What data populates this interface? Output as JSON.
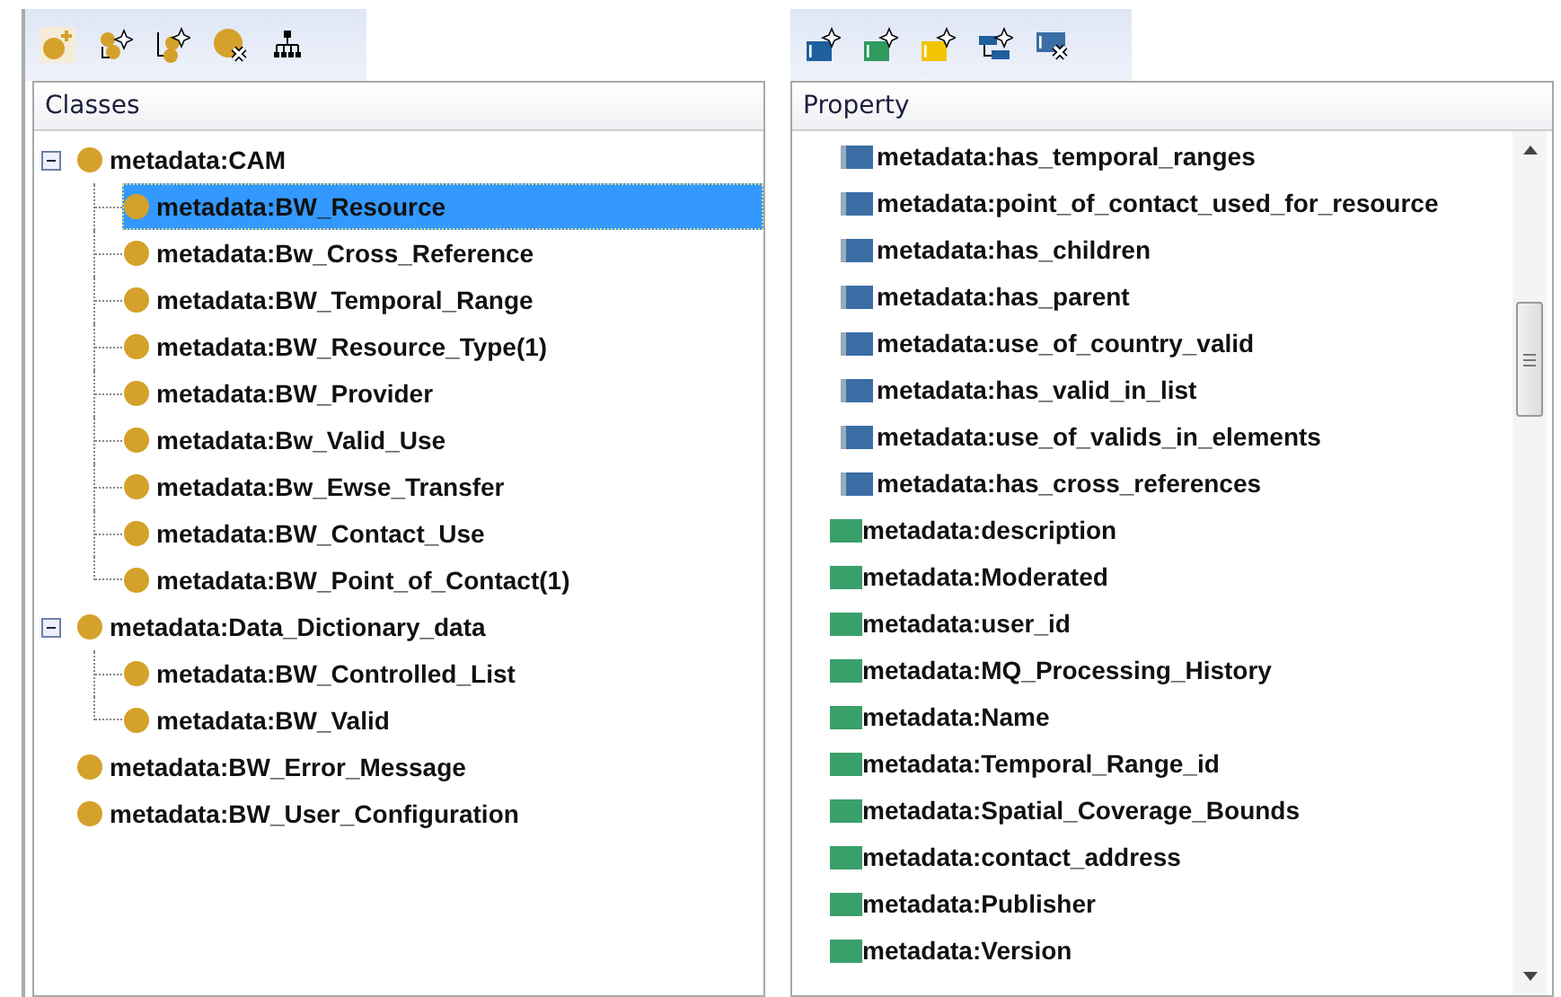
{
  "classes": {
    "title": "Classes",
    "items": [
      {
        "label": "metadata:CAM",
        "expanded": true,
        "selected": false,
        "children": [
          {
            "label": "metadata:BW_Resource",
            "selected": true
          },
          {
            "label": "metadata:Bw_Cross_Reference",
            "selected": false
          },
          {
            "label": "metadata:BW_Temporal_Range",
            "selected": false
          },
          {
            "label": "metadata:BW_Resource_Type(1)",
            "selected": false
          },
          {
            "label": "metadata:BW_Provider",
            "selected": false
          },
          {
            "label": "metadata:Bw_Valid_Use",
            "selected": false
          },
          {
            "label": "metadata:Bw_Ewse_Transfer",
            "selected": false
          },
          {
            "label": "metadata:BW_Contact_Use",
            "selected": false
          },
          {
            "label": "metadata:BW_Point_of_Contact(1)",
            "selected": false
          }
        ]
      },
      {
        "label": "metadata:Data_Dictionary_data",
        "expanded": true,
        "selected": false,
        "children": [
          {
            "label": "metadata:BW_Controlled_List",
            "selected": false
          },
          {
            "label": "metadata:BW_Valid",
            "selected": false
          }
        ]
      },
      {
        "label": "metadata:BW_Error_Message",
        "selected": false
      },
      {
        "label": "metadata:BW_User_Configuration",
        "selected": false
      }
    ]
  },
  "property": {
    "title": "Property",
    "items": [
      {
        "kind": "object",
        "label": "metadata:has_temporal_ranges"
      },
      {
        "kind": "object",
        "label": "metadata:point_of_contact_used_for_resource"
      },
      {
        "kind": "object",
        "label": "metadata:has_children"
      },
      {
        "kind": "object",
        "label": "metadata:has_parent"
      },
      {
        "kind": "object",
        "label": "metadata:use_of_country_valid"
      },
      {
        "kind": "object",
        "label": "metadata:has_valid_in_list"
      },
      {
        "kind": "object",
        "label": "metadata:use_of_valids_in_elements"
      },
      {
        "kind": "object",
        "label": "metadata:has_cross_references"
      },
      {
        "kind": "data",
        "label": "metadata:description"
      },
      {
        "kind": "data",
        "label": "metadata:Moderated"
      },
      {
        "kind": "data",
        "label": "metadata:user_id"
      },
      {
        "kind": "data",
        "label": "metadata:MQ_Processing_History"
      },
      {
        "kind": "data",
        "label": "metadata:Name"
      },
      {
        "kind": "data",
        "label": "metadata:Temporal_Range_id"
      },
      {
        "kind": "data",
        "label": "metadata:Spatial_Coverage_Bounds"
      },
      {
        "kind": "data",
        "label": "metadata:contact_address"
      },
      {
        "kind": "data",
        "label": "metadata:Publisher"
      },
      {
        "kind": "data",
        "label": "metadata:Version"
      }
    ]
  }
}
